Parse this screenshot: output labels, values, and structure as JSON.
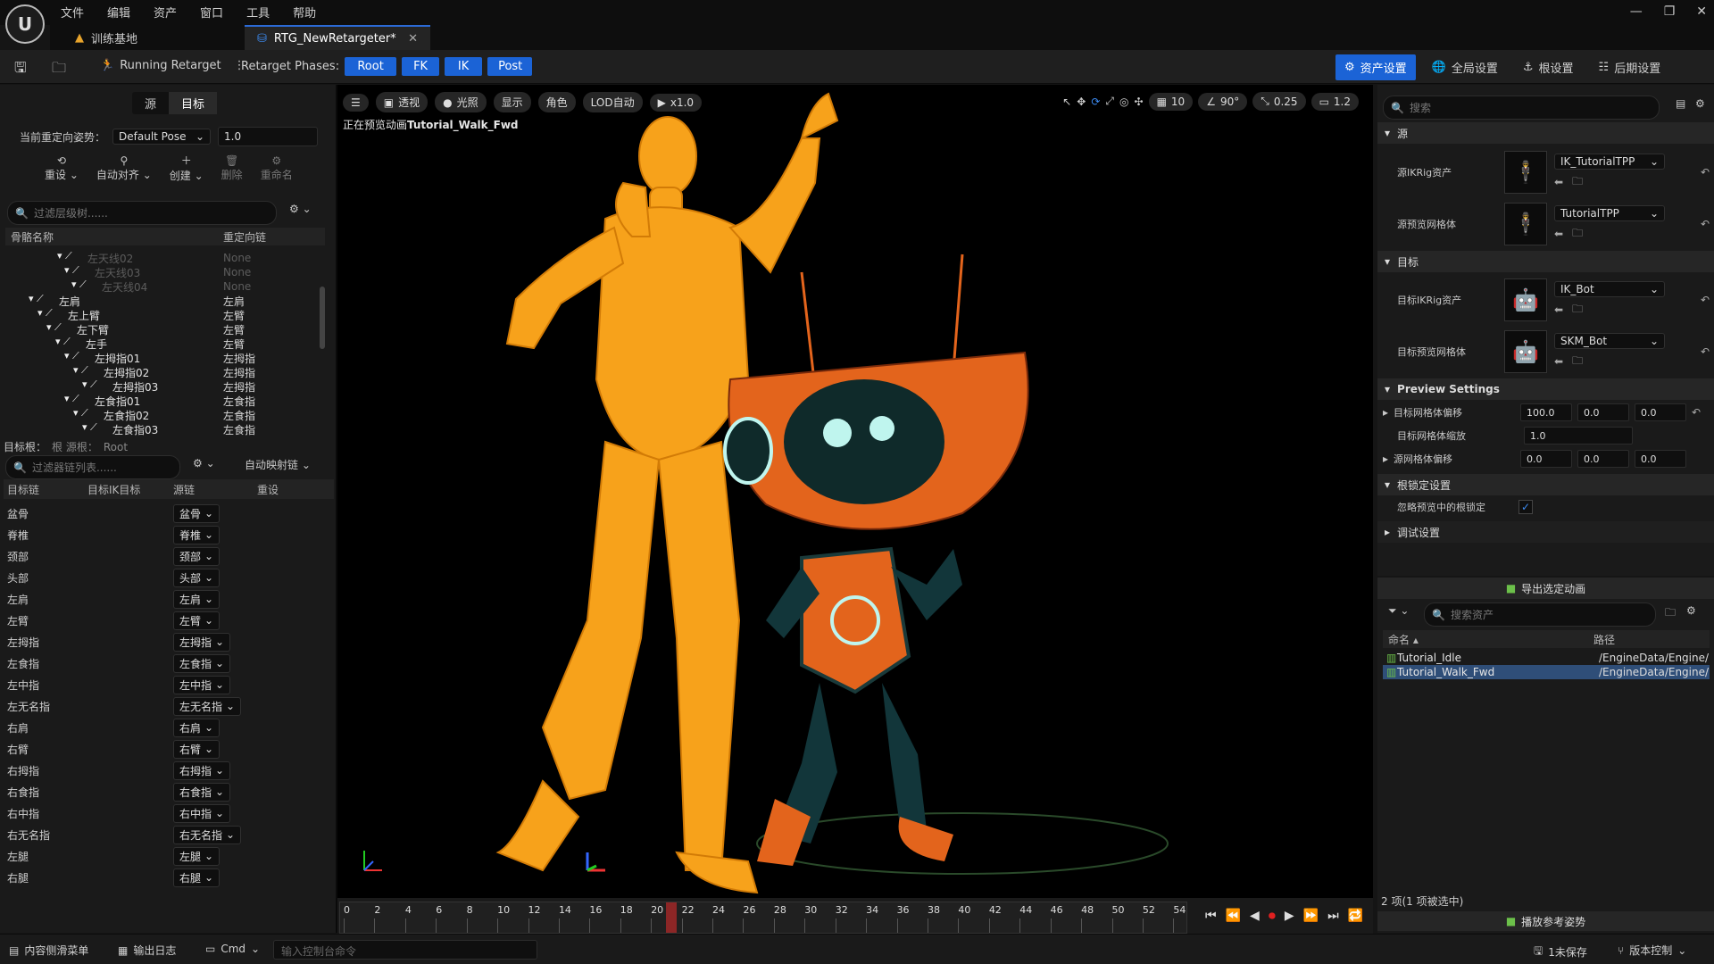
{
  "menu": [
    "文件",
    "编辑",
    "资产",
    "窗口",
    "工具",
    "帮助"
  ],
  "tabs": [
    {
      "label": "训练基地"
    },
    {
      "label": "RTG_NewRetargeter*"
    }
  ],
  "toolbar": {
    "running": "Running Retarget",
    "phases_label": "Retarget Phases:",
    "phases": [
      "Root",
      "FK",
      "IK",
      "Post"
    ],
    "right": [
      {
        "label": "资产设置",
        "icon": "asset-settings-icon"
      },
      {
        "label": "全局设置",
        "icon": "globe-icon"
      },
      {
        "label": "根设置",
        "icon": "root-icon"
      },
      {
        "label": "后期设置",
        "icon": "post-settings-icon"
      }
    ]
  },
  "left": {
    "seg": [
      "源",
      "目标"
    ],
    "pose_label": "当前重定向姿势：",
    "pose_value": "Default Pose",
    "pose_num": "1.0",
    "tools": [
      "重设",
      "自动对齐",
      "创建",
      "删除",
      "重命名"
    ],
    "tree_search": "过滤层级树......",
    "tree_headers": [
      "骨骼名称",
      "重定向链"
    ],
    "tree": [
      {
        "name": "左天线02",
        "chain": "None",
        "dim": true,
        "indent": 88
      },
      {
        "name": "左天线03",
        "chain": "None",
        "dim": true,
        "indent": 96
      },
      {
        "name": "左天线04",
        "chain": "None",
        "dim": true,
        "indent": 104
      },
      {
        "name": "左肩",
        "chain": "左肩",
        "dim": false,
        "indent": 56
      },
      {
        "name": "左上臂",
        "chain": "左臂",
        "dim": false,
        "indent": 66
      },
      {
        "name": "左下臂",
        "chain": "左臂",
        "dim": false,
        "indent": 76
      },
      {
        "name": "左手",
        "chain": "左臂",
        "dim": false,
        "indent": 86
      },
      {
        "name": "左拇指01",
        "chain": "左拇指",
        "dim": false,
        "indent": 96
      },
      {
        "name": "左拇指02",
        "chain": "左拇指",
        "dim": false,
        "indent": 106
      },
      {
        "name": "左拇指03",
        "chain": "左拇指",
        "dim": false,
        "indent": 116
      },
      {
        "name": "左食指01",
        "chain": "左食指",
        "dim": false,
        "indent": 96
      },
      {
        "name": "左食指02",
        "chain": "左食指",
        "dim": false,
        "indent": 106
      },
      {
        "name": "左食指03",
        "chain": "左食指",
        "dim": false,
        "indent": 116
      }
    ],
    "root_label": "目标根：",
    "root_src": "根 源根：",
    "root_val": "Root",
    "chain_search": "过滤器链列表......",
    "automap": "自动映射链",
    "chain_headers": [
      "目标链",
      "目标IK目标",
      "源链",
      "重设"
    ],
    "chains": [
      {
        "t": "盆骨",
        "s": "盆骨"
      },
      {
        "t": "脊椎",
        "s": "脊椎"
      },
      {
        "t": "颈部",
        "s": "颈部"
      },
      {
        "t": "头部",
        "s": "头部"
      },
      {
        "t": "左肩",
        "s": "左肩"
      },
      {
        "t": "左臂",
        "s": "左臂"
      },
      {
        "t": "左拇指",
        "s": "左拇指"
      },
      {
        "t": "左食指",
        "s": "左食指"
      },
      {
        "t": "左中指",
        "s": "左中指"
      },
      {
        "t": "左无名指",
        "s": "左无名指"
      },
      {
        "t": "右肩",
        "s": "右肩"
      },
      {
        "t": "右臂",
        "s": "右臂"
      },
      {
        "t": "右拇指",
        "s": "右拇指"
      },
      {
        "t": "右食指",
        "s": "右食指"
      },
      {
        "t": "右中指",
        "s": "右中指"
      },
      {
        "t": "右无名指",
        "s": "右无名指"
      },
      {
        "t": "左腿",
        "s": "左腿"
      },
      {
        "t": "右腿",
        "s": "右腿"
      }
    ]
  },
  "viewport": {
    "buttons": [
      "透视",
      "光照",
      "显示",
      "角色",
      "LOD自动",
      "x1.0"
    ],
    "right_vals": [
      "10",
      "90°",
      "0.25",
      "1.2"
    ],
    "status_prefix": "正在预览动画",
    "status_anim": "Tutorial_Walk_Fwd",
    "ticks": [
      "0",
      "2",
      "4",
      "6",
      "8",
      "10",
      "12",
      "14",
      "16",
      "18",
      "20",
      "22",
      "24",
      "26",
      "28",
      "30",
      "32",
      "34",
      "36",
      "38",
      "40",
      "42",
      "44",
      "46",
      "48",
      "50",
      "52",
      "54"
    ],
    "playhead": "21"
  },
  "right": {
    "search": "搜索",
    "sec_source": "源",
    "sec_target": "目标",
    "sec_preview": "Preview Settings",
    "sec_rootlock": "根锁定设置",
    "sec_debug": "调试设置",
    "src_ik_label": "源IKRig资产",
    "src_ik": "IK_TutorialTPP",
    "src_mesh_label": "源预览网格体",
    "src_mesh": "TutorialTPP",
    "tgt_ik_label": "目标IKRig资产",
    "tgt_ik": "IK_Bot",
    "tgt_mesh_label": "目标预览网格体",
    "tgt_mesh": "SKM_Bot",
    "offset_label": "目标网格体偏移",
    "offset": [
      "100.0",
      "0.0",
      "0.0"
    ],
    "scale_label": "目标网格体缩放",
    "scale": "1.0",
    "src_offset_label": "源网格体偏移",
    "src_offset": [
      "0.0",
      "0.0",
      "0.0"
    ],
    "ignore_label": "忽略预览中的根锁定"
  },
  "assets": {
    "export": "导出选定动画",
    "search": "搜索资产",
    "headers": [
      "命名",
      "路径"
    ],
    "items": [
      {
        "name": "Tutorial_Idle",
        "path": "/EngineData/Engine/"
      },
      {
        "name": "Tutorial_Walk_Fwd",
        "path": "/EngineData/Engine/"
      }
    ],
    "count": "2 项(1 项被选中)",
    "play_ref": "播放参考姿势"
  },
  "status": {
    "drawer": "内容侧滑菜单",
    "log": "输出日志",
    "cmd": "Cmd",
    "cmd_placeholder": "输入控制台命令",
    "unsaved": "1未保存",
    "vc": "版本控制"
  },
  "colors": {
    "accent": "#1b63d6",
    "mannequin": "#f7a21b",
    "bot": "#e3641c",
    "eyes": "#bff5ee"
  }
}
